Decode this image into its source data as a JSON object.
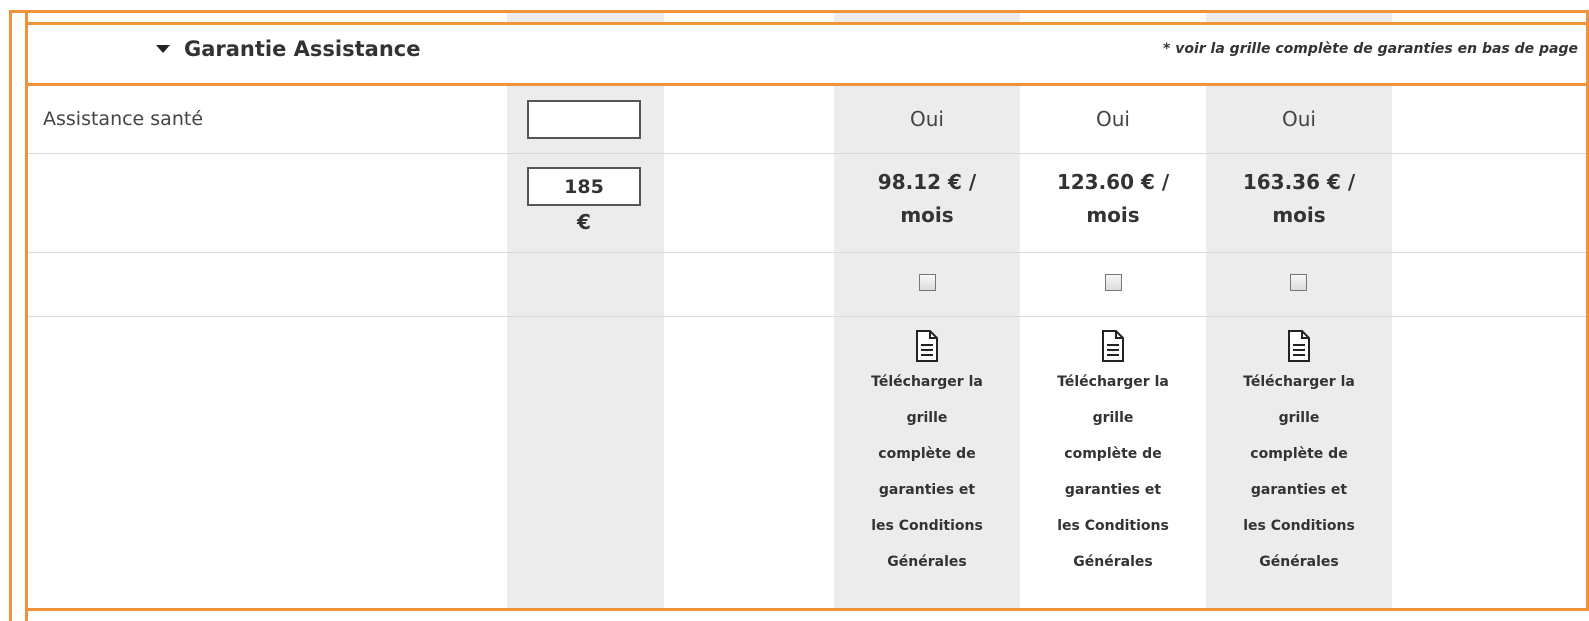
{
  "section": {
    "title": "Garantie Assistance",
    "note": "* voir la grille complète de garanties en bas de page"
  },
  "rows": {
    "assistance": {
      "label": "Assistance santé",
      "input_value": "",
      "plans": [
        "Oui",
        "Oui",
        "Oui"
      ]
    },
    "budget": {
      "input_value": "185",
      "currency": "€",
      "prices": [
        {
          "amount": "98.12 € /",
          "period": "mois"
        },
        {
          "amount": "123.60 € /",
          "period": "mois"
        },
        {
          "amount": "163.36 € /",
          "period": "mois"
        }
      ]
    },
    "download": {
      "lines": [
        "Télécharger la",
        "grille",
        "complète de",
        "garanties et",
        "les Conditions",
        "Générales"
      ]
    }
  },
  "colors": {
    "frame": "#f0923a",
    "column_shade": "#ececec"
  }
}
